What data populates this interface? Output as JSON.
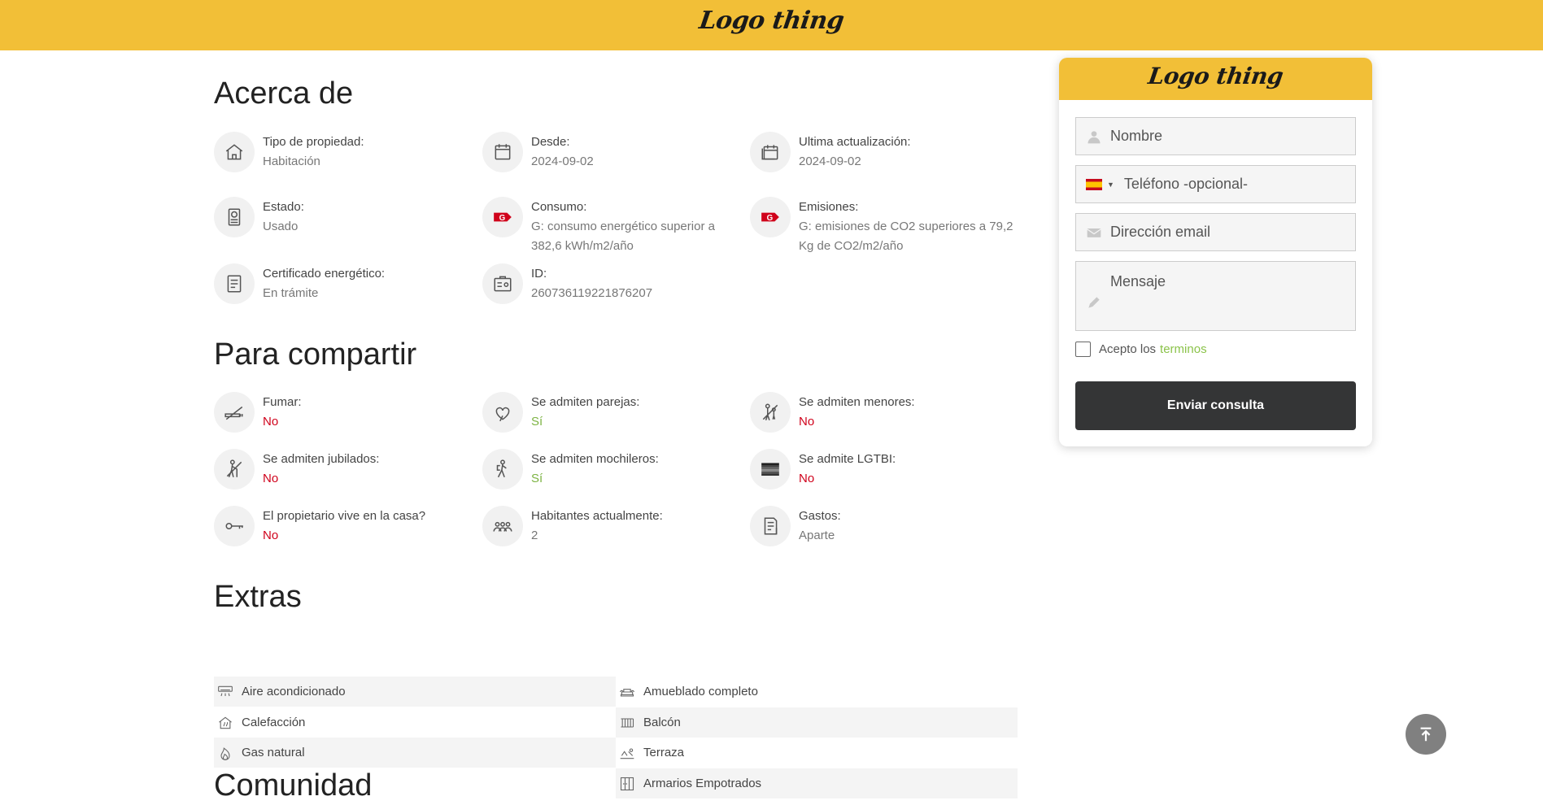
{
  "header": {
    "logo_text": "Logo thing"
  },
  "sections": {
    "acerca": "Acerca de",
    "compartir": "Para compartir",
    "extras": "Extras",
    "comunidad": "Comunidad"
  },
  "acerca": [
    {
      "label": "Tipo de propiedad:",
      "value": "Habitación",
      "icon": "house-icon"
    },
    {
      "label": "Desde:",
      "value": "2024-09-02",
      "icon": "calendar-icon"
    },
    {
      "label": "Ultima actualización:",
      "value": "2024-09-02",
      "icon": "calendar-update-icon"
    },
    {
      "label": "Estado:",
      "value": "Usado",
      "icon": "appliance-icon"
    },
    {
      "label": "Consumo:",
      "value": "G: consumo energético superior a 382,6 kWh/m2/año",
      "icon": "energy-g-icon"
    },
    {
      "label": "Emisiones:",
      "value": "G: emisiones de CO2 superiores a 79,2 Kg de CO2/m2/año",
      "icon": "emissions-g-icon"
    },
    {
      "label": "Certificado energético:",
      "value": "En trámite",
      "icon": "certificate-icon"
    },
    {
      "label": "ID:",
      "value": "260736119221876207",
      "icon": "id-card-icon"
    }
  ],
  "compartir": [
    {
      "label": "Fumar:",
      "value": "No",
      "status": "no",
      "icon": "no-smoking-icon"
    },
    {
      "label": "Se admiten parejas:",
      "value": "Sí",
      "status": "yes",
      "icon": "hearts-icon"
    },
    {
      "label": "Se admiten menores:",
      "value": "No",
      "status": "no",
      "icon": "children-icon"
    },
    {
      "label": "Se admiten jubilados:",
      "value": "No",
      "status": "no",
      "icon": "elderly-icon"
    },
    {
      "label": "Se admiten mochileros:",
      "value": "Sí",
      "status": "yes",
      "icon": "backpacker-icon"
    },
    {
      "label": "Se admite LGTBI:",
      "value": "No",
      "status": "no",
      "icon": "rainbow-flag-icon"
    },
    {
      "label": "El propietario vive en la casa?",
      "value": "No",
      "status": "no",
      "icon": "key-icon"
    },
    {
      "label": "Habitantes actualmente:",
      "value": "2",
      "status": "neutral",
      "icon": "people-icon"
    },
    {
      "label": "Gastos:",
      "value": "Aparte",
      "status": "neutral",
      "icon": "bill-icon"
    }
  ],
  "extras": [
    {
      "label": "Aire acondicionado",
      "icon": "air-conditioner-icon"
    },
    {
      "label": "Amueblado completo",
      "icon": "sofa-icon"
    },
    {
      "label": "Calefacción",
      "icon": "heating-icon"
    },
    {
      "label": "Balcón",
      "icon": "balcony-icon"
    },
    {
      "label": "Gas natural",
      "icon": "flame-icon"
    },
    {
      "label": "Terraza",
      "icon": "terrace-icon"
    },
    {
      "label": "Armarios Empotrados",
      "icon": "wardrobe-icon"
    }
  ],
  "contact": {
    "logo_text": "Logo thing",
    "name_placeholder": "Nombre",
    "phone_placeholder": "Teléfono -opcional-",
    "email_placeholder": "Dirección email",
    "message_placeholder": "Mensaje",
    "terms_prefix": "Acepto los",
    "terms_link": "terminos",
    "submit_label": "Enviar consulta"
  },
  "colors": {
    "brand_yellow": "#f2bf37",
    "no_red": "#d0021b",
    "yes_green": "#7cb342",
    "button_dark": "#343536"
  }
}
